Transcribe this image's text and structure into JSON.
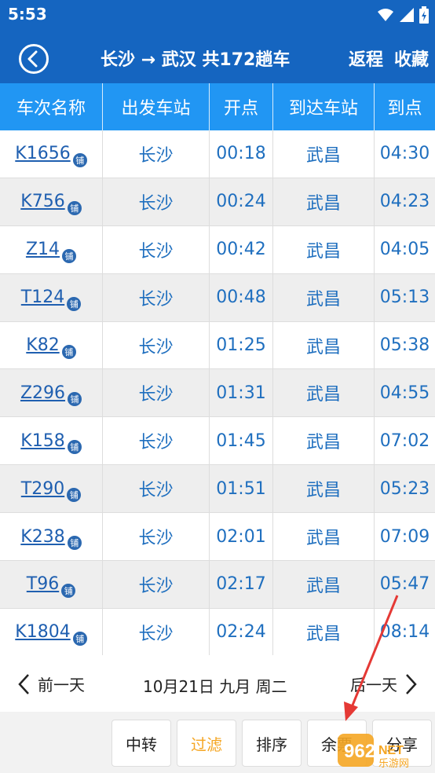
{
  "status_bar": {
    "time": "5:53"
  },
  "app_bar": {
    "title": "长沙 → 武汉 共172趟车",
    "return_label": "返程",
    "favorite_label": "收藏"
  },
  "table": {
    "headers": [
      "车次名称",
      "出发车站",
      "开点",
      "到达车站",
      "到点"
    ],
    "badge": "铺",
    "rows": [
      {
        "train": "K1656",
        "from": "长沙",
        "depart": "00:18",
        "to": "武昌",
        "arrive": "04:30"
      },
      {
        "train": "K756",
        "from": "长沙",
        "depart": "00:24",
        "to": "武昌",
        "arrive": "04:23"
      },
      {
        "train": "Z14",
        "from": "长沙",
        "depart": "00:42",
        "to": "武昌",
        "arrive": "04:05"
      },
      {
        "train": "T124",
        "from": "长沙",
        "depart": "00:48",
        "to": "武昌",
        "arrive": "05:13"
      },
      {
        "train": "K82",
        "from": "长沙",
        "depart": "01:25",
        "to": "武昌",
        "arrive": "05:38"
      },
      {
        "train": "Z296",
        "from": "长沙",
        "depart": "01:31",
        "to": "武昌",
        "arrive": "04:55"
      },
      {
        "train": "K158",
        "from": "长沙",
        "depart": "01:45",
        "to": "武昌",
        "arrive": "07:02"
      },
      {
        "train": "T290",
        "from": "长沙",
        "depart": "01:51",
        "to": "武昌",
        "arrive": "05:23"
      },
      {
        "train": "K238",
        "from": "长沙",
        "depart": "02:01",
        "to": "武昌",
        "arrive": "07:09"
      },
      {
        "train": "T96",
        "from": "长沙",
        "depart": "02:17",
        "to": "武昌",
        "arrive": "05:47"
      },
      {
        "train": "K1804",
        "from": "长沙",
        "depart": "02:24",
        "to": "武昌",
        "arrive": "08:14"
      }
    ]
  },
  "date_bar": {
    "prev_label": "前一天",
    "date": "10月21日 九月 周二",
    "next_label": "后一天"
  },
  "toolbar": {
    "transfer": "中转",
    "filter": "过滤",
    "sort": "排序",
    "remaining": "余票",
    "more": "分享"
  },
  "watermark": {
    "text": "962",
    "subtext": "乐游网"
  },
  "colors": {
    "header_bg": "#1565c0",
    "table_header_bg": "#2196f3",
    "link": "#1f5fb0",
    "accent": "#f5a623",
    "arrow": "#e53935"
  },
  "icons": {
    "back": "chevron-left-circle-icon",
    "wifi": "wifi-icon",
    "signal": "signal-icon",
    "battery": "battery-icon",
    "prev": "chevron-left-icon",
    "next": "chevron-right-icon"
  }
}
